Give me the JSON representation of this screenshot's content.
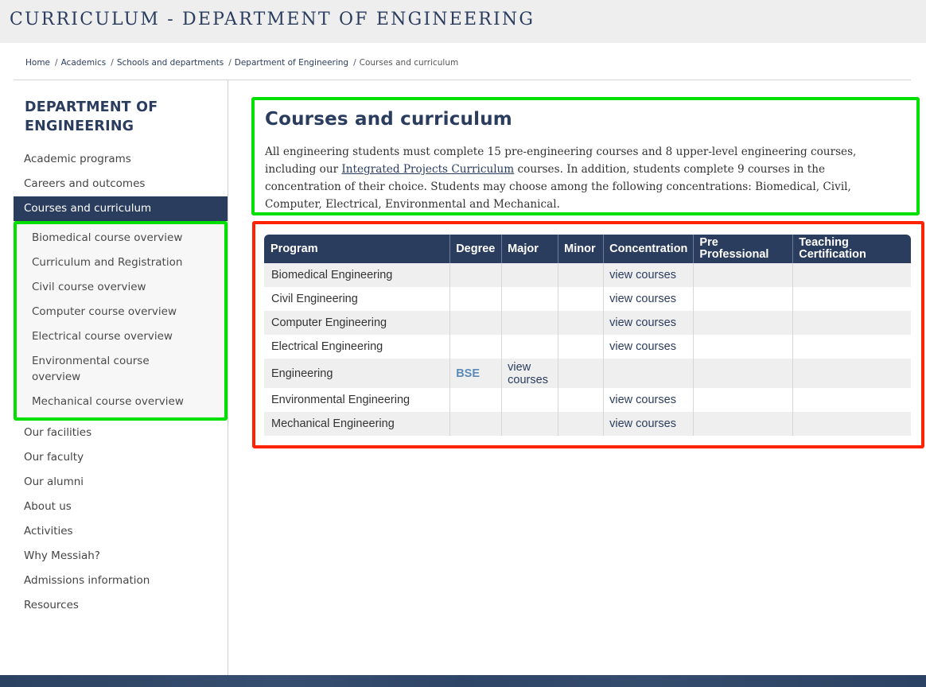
{
  "header": {
    "title": "CURRICULUM - DEPARTMENT OF ENGINEERING"
  },
  "breadcrumb": {
    "items": [
      "Home",
      "Academics",
      "Schools and departments",
      "Department of Engineering"
    ],
    "current": "Courses and curriculum",
    "separator": "/"
  },
  "sidebar": {
    "title": "DEPARTMENT OF ENGINEERING",
    "items_before": [
      "Academic programs",
      "Careers and outcomes"
    ],
    "active": "Courses and curriculum",
    "subitems": [
      "Biomedical course overview",
      "Curriculum and Registration",
      "Civil course overview",
      "Computer course overview",
      "Electrical course overview",
      "Environmental course overview",
      "Mechanical course overview"
    ],
    "items_after": [
      "Our facilities",
      "Our faculty",
      "Our alumni",
      "About us",
      "Activities",
      "Why Messiah?",
      "Admissions information",
      "Resources"
    ]
  },
  "main": {
    "title": "Courses and curriculum",
    "intro_before_link": "All engineering students must complete 15 pre-engineering courses and 8 upper-level engineering courses, including our ",
    "intro_link": "Integrated Projects Curriculum",
    "intro_after_link": " courses. In addition, students complete 9 courses in the concentration of their choice. Students may choose among the following concentrations: Biomedical, Civil, Computer, Electrical, Environmental and Mechanical."
  },
  "table": {
    "headers": [
      "Program",
      "Degree",
      "Major",
      "Minor",
      "Concentration",
      "Pre Professional",
      "Teaching Certification"
    ],
    "rows": [
      {
        "program": "Biomedical Engineering",
        "degree": "",
        "major": "",
        "minor": "",
        "concentration": "view courses",
        "pre_professional": "",
        "teaching": ""
      },
      {
        "program": "Civil Engineering",
        "degree": "",
        "major": "",
        "minor": "",
        "concentration": "view courses",
        "pre_professional": "",
        "teaching": ""
      },
      {
        "program": "Computer Engineering",
        "degree": "",
        "major": "",
        "minor": "",
        "concentration": "view courses",
        "pre_professional": "",
        "teaching": ""
      },
      {
        "program": "Electrical Engineering",
        "degree": "",
        "major": "",
        "minor": "",
        "concentration": "view courses",
        "pre_professional": "",
        "teaching": ""
      },
      {
        "program": "Engineering",
        "degree": "BSE",
        "major": "view courses",
        "minor": "",
        "concentration": "",
        "pre_professional": "",
        "teaching": ""
      },
      {
        "program": "Environmental Engineering",
        "degree": "",
        "major": "",
        "minor": "",
        "concentration": "view courses",
        "pre_professional": "",
        "teaching": ""
      },
      {
        "program": "Mechanical Engineering",
        "degree": "",
        "major": "",
        "minor": "",
        "concentration": "view courses",
        "pre_professional": "",
        "teaching": ""
      }
    ]
  },
  "colors": {
    "brand_navy": "#2b3d5e",
    "annotation_green": "#00e000",
    "annotation_red": "#ff2200",
    "degree_link": "#5a8bb8"
  }
}
